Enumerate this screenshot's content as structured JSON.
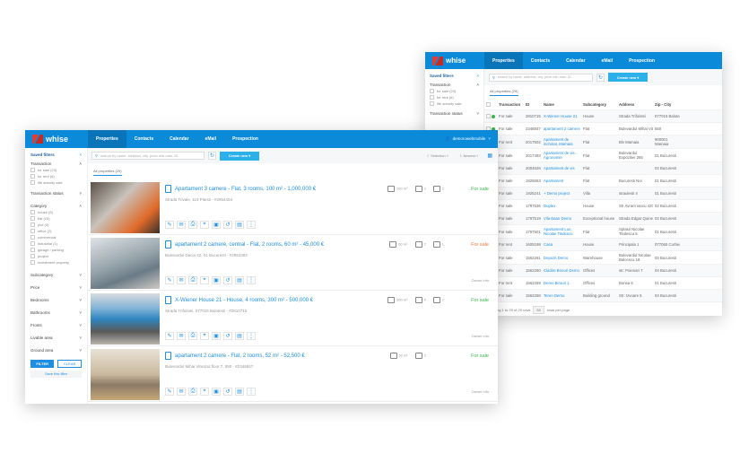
{
  "brand": "whise",
  "nav": [
    "Properties",
    "Contacts",
    "Calendar",
    "eMail",
    "Prospection"
  ],
  "user": "demorowebmobile",
  "search_placeholder": "search by name, address, city, price min-max, ID",
  "create_new": "Create new",
  "tab_all": "All properties (29)",
  "selection": "Selection",
  "sort": "Newest",
  "sidebar": {
    "saved_filters": "Saved filters",
    "transaction": "Transaction",
    "transaction_opts": [
      "for sale (23)",
      "for rent (6)",
      "life annuity sale"
    ],
    "transaction_status": "Transaction status",
    "category": "Category",
    "category_opts": [
      "house (8)",
      "flat (15)",
      "plot (3)",
      "office (2)",
      "commercial",
      "industrial (1)",
      "garage / parking",
      "project",
      "investment property"
    ],
    "sections": [
      "Subcategory",
      "Price",
      "Bedrooms",
      "Bathrooms",
      "Fronts",
      "Livable area",
      "Ground area"
    ],
    "filter": "FILTER",
    "clear": "CLEAR",
    "save_filter": "Save this filter"
  },
  "table": {
    "headers": [
      "Transaction",
      "ID",
      "Name",
      "Subcategory",
      "Address",
      "Zip - City"
    ],
    "rows": [
      [
        "For sale",
        "2810715",
        "X-Wiener House 21",
        "House",
        "Strada Trifoistei",
        "077015 Balotesti",
        "#3bb54a"
      ],
      [
        "For sale",
        "2348847",
        "apartament 2 camere",
        "Flat",
        "Bulevardul Mihai Viteazul",
        "550",
        "#3bb54a"
      ],
      [
        "For rent",
        "2017502",
        "Apartament de inchiriat, Mamaia",
        "Flat",
        "Blv Mamaia",
        "900001 Mamaia",
        "#f07a3a"
      ],
      [
        "For sale",
        "2017493",
        "Apartament de vis - Agronomie",
        "Flat",
        "Bulevardul Expozitiei 265",
        "01 Bucuresti",
        "#f07a3a"
      ],
      [
        "For sale",
        "2004626",
        "Apartament de vis",
        "Flat",
        "",
        "02 Bucuresti",
        "#f07a3a"
      ],
      [
        "For sale",
        "1925653",
        "Apartament",
        "Flat",
        "Bucuresti Noi",
        "01 Bucuresti",
        "#f07a3a"
      ],
      [
        "For sale",
        "1925241",
        "+ Demo project",
        "Villa",
        "straulesti 4",
        "01 Bucuresti",
        "#3bb54a"
      ],
      [
        "For sale",
        "1797536",
        "Duplex",
        "House",
        "Str Avram Iancu 420",
        "02 Bucuresti",
        "#f07a3a"
      ],
      [
        "For sale",
        "1797519",
        "Vila Baan Demo",
        "Exceptional house",
        "Strada Edgar Quinet 1-7",
        "02 Bucuresti",
        "#f07a3a"
      ],
      [
        "For sale",
        "1797501",
        "Apartament Lux, Nicolae Titulescu",
        "Flat",
        "Splaiul Nicolae Titulescu 5",
        "01 Bucuresti",
        "#f07a3a"
      ],
      [
        "For rent",
        "1605198",
        "Casa",
        "House",
        "Principala 1",
        "077065 Corbeanca",
        "#f07a3a"
      ],
      [
        "For sale",
        "1562261",
        "Depozit Demo",
        "Warehouse",
        "Bulevardul Nicolae Balcescu 18",
        "03 Bucuresti",
        "#f07a3a"
      ],
      [
        "For sale",
        "1562260",
        "Cladire Birouri Demo",
        "Offices",
        "str: Poienari 7",
        "04 Bucuresti",
        "#3bb54a"
      ],
      [
        "For rent",
        "1562259",
        "Demo Birouri 1",
        "Offices",
        "Bonsa 6",
        "01 Bucuresti",
        "#3bb54a"
      ],
      [
        "For sale",
        "1562258",
        "Teren Demo",
        "Building ground",
        "Str: Izvoare 5",
        "04 Bucuresti",
        "#3bb54a"
      ]
    ],
    "footer": "ng 1 to 29 of 29 rows",
    "per_page": "50",
    "per_page_label": "rows per page"
  },
  "cards": [
    {
      "title": "Apartament 3 camere - Flat, 3 rooms, 100 m² - 1,000,000 €",
      "addr": "Strada Trivale, 110 Pitesti - #2954404",
      "area": "100 m²",
      "beds": "3",
      "baths": "2",
      "status": "For sale",
      "color": "#3bb54a",
      "owner": "",
      "photo": "linear-gradient(135deg,#5a5048,#c9c3bb 40%,#e06a2a 75%,#3a302a)"
    },
    {
      "title": "apartament 2 camere, central - Flat, 2 rooms, 60 m² - 45,000 €",
      "addr": "Bulevardul Dacia 42, 01 Bucuresti - #2954383",
      "area": "60 m²",
      "beds": "2",
      "baths": "1",
      "status": "For sale",
      "color": "#f07a3a",
      "owner": "Owner info",
      "photo": "linear-gradient(160deg,#dfe3e6,#9aa7ae 45%,#6b7b86 70%,#cfcac5)"
    },
    {
      "title": "X-Wiener House 21 - House, 4 rooms, 300 m² - 500,000 €",
      "addr": "Strada Trifoistei, 077015 Balotesti - #2810715",
      "area": "300 m²",
      "beds": "4",
      "baths": "2",
      "status": "For sale",
      "color": "#3bb54a",
      "owner": "Owner info",
      "photo": "linear-gradient(180deg,#d9dcdf,#7fb1d6 30%,#2f86c0 50%,#5a5a58 75%,#b9b5ae)"
    },
    {
      "title": "apartament 2 camere - Flat, 2 rooms, 52 m² - 52,500 €",
      "addr": "Bulevardul Mihai Viteazul floor 7, 550 - #2348847",
      "area": "52 m²",
      "beds": "2",
      "baths": "",
      "status": "For sale",
      "color": "#3bb54a",
      "owner": "Owner info",
      "photo": "linear-gradient(180deg,#e8e2d6,#c9b89c 50%,#8b7a66 70%,#c7a878)"
    }
  ]
}
